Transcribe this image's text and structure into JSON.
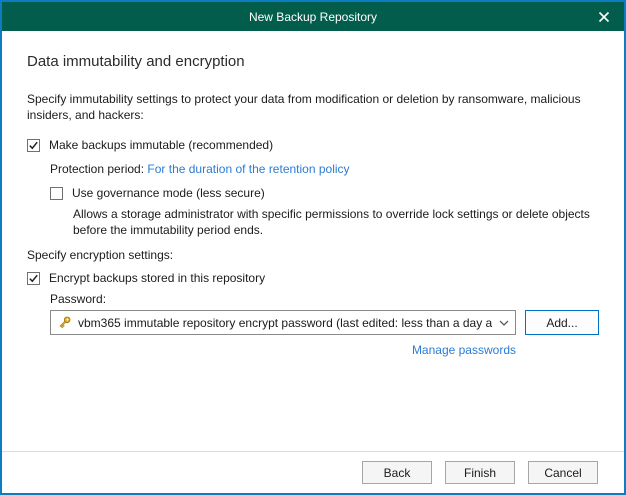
{
  "window": {
    "title": "New Backup Repository"
  },
  "heading": "Data immutability and encryption",
  "immutability": {
    "intro_line1": "Specify immutability settings to protect your data from modification or deletion by ransomware, malicious",
    "intro_line2": "insiders, and hackers:",
    "make_immutable": {
      "label": "Make backups immutable (recommended)",
      "checked": true
    },
    "protection_period_label": "Protection period:",
    "protection_period_value": "For the duration of the retention policy",
    "governance": {
      "label": "Use governance mode (less secure)",
      "checked": false
    },
    "governance_desc_line1": "Allows a storage administrator with specific permissions to override lock settings or delete objects",
    "governance_desc_line2": "before the immutability period ends."
  },
  "encryption": {
    "intro": "Specify encryption settings:",
    "encrypt": {
      "label": "Encrypt backups stored in this repository",
      "checked": true
    },
    "password_label": "Password:",
    "password_value": "vbm365 immutable repository encrypt password (last edited: less than a day a",
    "add_button": "Add...",
    "manage_link": "Manage passwords"
  },
  "footer": {
    "back": "Back",
    "finish": "Finish",
    "cancel": "Cancel"
  },
  "colors": {
    "titlebar_green": "#035d4c",
    "window_border_blue": "#0c7dc2",
    "link_blue": "#2b7cd3",
    "add_button_border": "#0072c6"
  }
}
